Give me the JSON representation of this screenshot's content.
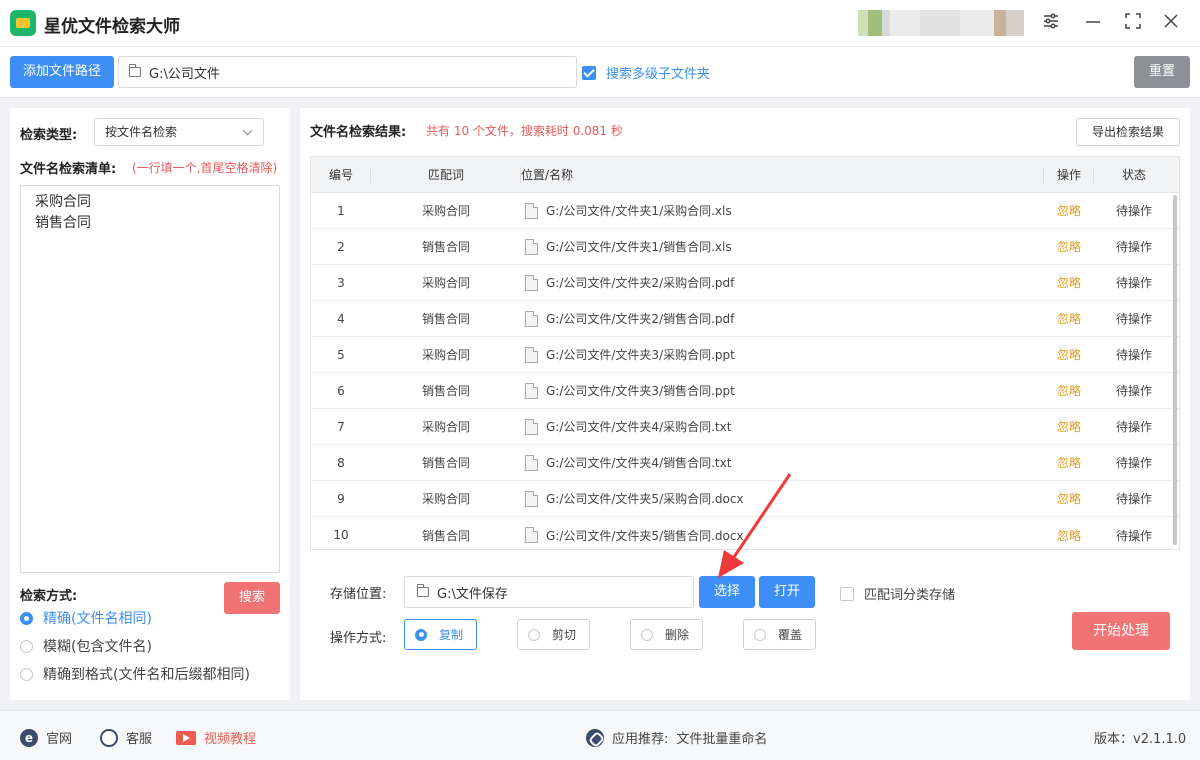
{
  "app": {
    "title": "星优文件检索大师"
  },
  "toolbar": {
    "add_path_label": "添加文件路径",
    "path_value": "G:\\公司文件",
    "subfolder_label": "搜索多级子文件夹",
    "subfolder_checked": true,
    "reset_label": "重置"
  },
  "left": {
    "search_type_label": "检索类型:",
    "search_type_value": "按文件名检索",
    "list_label": "文件名检索清单:",
    "list_hint": "(一行填一个,首尾空格清除)",
    "keywords": [
      "采购合同",
      "销售合同"
    ],
    "search_button": "搜索",
    "mode_label": "检索方式:",
    "modes": [
      {
        "label": "精确(文件名相同)",
        "selected": true
      },
      {
        "label": "模糊(包含文件名)",
        "selected": false
      },
      {
        "label": "精确到格式(文件名和后缀都相同)",
        "selected": false
      }
    ]
  },
  "results": {
    "label": "文件名检索结果:",
    "summary": "共有 10 个文件，搜索耗时 0.081 秒",
    "export_button": "导出检索结果",
    "columns": {
      "no": "编号",
      "keyword": "匹配词",
      "path": "位置/名称",
      "op": "操作",
      "status": "状态"
    },
    "rows": [
      {
        "no": "1",
        "keyword": "采购合同",
        "path": "G:/公司文件/文件夹1/采购合同.xls",
        "op": "忽略",
        "status": "待操作"
      },
      {
        "no": "2",
        "keyword": "销售合同",
        "path": "G:/公司文件/文件夹1/销售合同.xls",
        "op": "忽略",
        "status": "待操作"
      },
      {
        "no": "3",
        "keyword": "采购合同",
        "path": "G:/公司文件/文件夹2/采购合同.pdf",
        "op": "忽略",
        "status": "待操作"
      },
      {
        "no": "4",
        "keyword": "销售合同",
        "path": "G:/公司文件/文件夹2/销售合同.pdf",
        "op": "忽略",
        "status": "待操作"
      },
      {
        "no": "5",
        "keyword": "采购合同",
        "path": "G:/公司文件/文件夹3/采购合同.ppt",
        "op": "忽略",
        "status": "待操作"
      },
      {
        "no": "6",
        "keyword": "销售合同",
        "path": "G:/公司文件/文件夹3/销售合同.ppt",
        "op": "忽略",
        "status": "待操作"
      },
      {
        "no": "7",
        "keyword": "采购合同",
        "path": "G:/公司文件/文件夹4/采购合同.txt",
        "op": "忽略",
        "status": "待操作"
      },
      {
        "no": "8",
        "keyword": "销售合同",
        "path": "G:/公司文件/文件夹4/销售合同.txt",
        "op": "忽略",
        "status": "待操作"
      },
      {
        "no": "9",
        "keyword": "采购合同",
        "path": "G:/公司文件/文件夹5/采购合同.docx",
        "op": "忽略",
        "status": "待操作"
      },
      {
        "no": "10",
        "keyword": "销售合同",
        "path": "G:/公司文件/文件夹5/销售合同.docx",
        "op": "忽略",
        "status": "待操作"
      }
    ]
  },
  "storage": {
    "label": "存储位置:",
    "path_value": "G:\\文件保存",
    "choose_button": "选择",
    "open_button": "打开",
    "classify_label": "匹配词分类存储",
    "classify_checked": false
  },
  "operation": {
    "label": "操作方式:",
    "options": [
      {
        "label": "复制",
        "selected": true
      },
      {
        "label": "剪切",
        "selected": false
      },
      {
        "label": "删除",
        "selected": false
      },
      {
        "label": "覆盖",
        "selected": false
      }
    ],
    "start_button": "开始处理"
  },
  "statusbar": {
    "website": "官网",
    "support": "客服",
    "video": "视频教程",
    "recommend_label": "应用推荐:",
    "recommend_app": "文件批量重命名",
    "version": "版本：v2.1.1.0"
  },
  "colors": {
    "accent": "#3d8ff5",
    "danger": "#f27373",
    "warning": "#e39b21"
  },
  "icons": [
    "app-logo-icon",
    "settings-sliders-icon",
    "minimize-icon",
    "maximize-icon",
    "close-icon",
    "folder-icon",
    "chevron-down-icon",
    "file-icon",
    "ie-icon",
    "chat-icon",
    "video-icon",
    "link-icon"
  ]
}
